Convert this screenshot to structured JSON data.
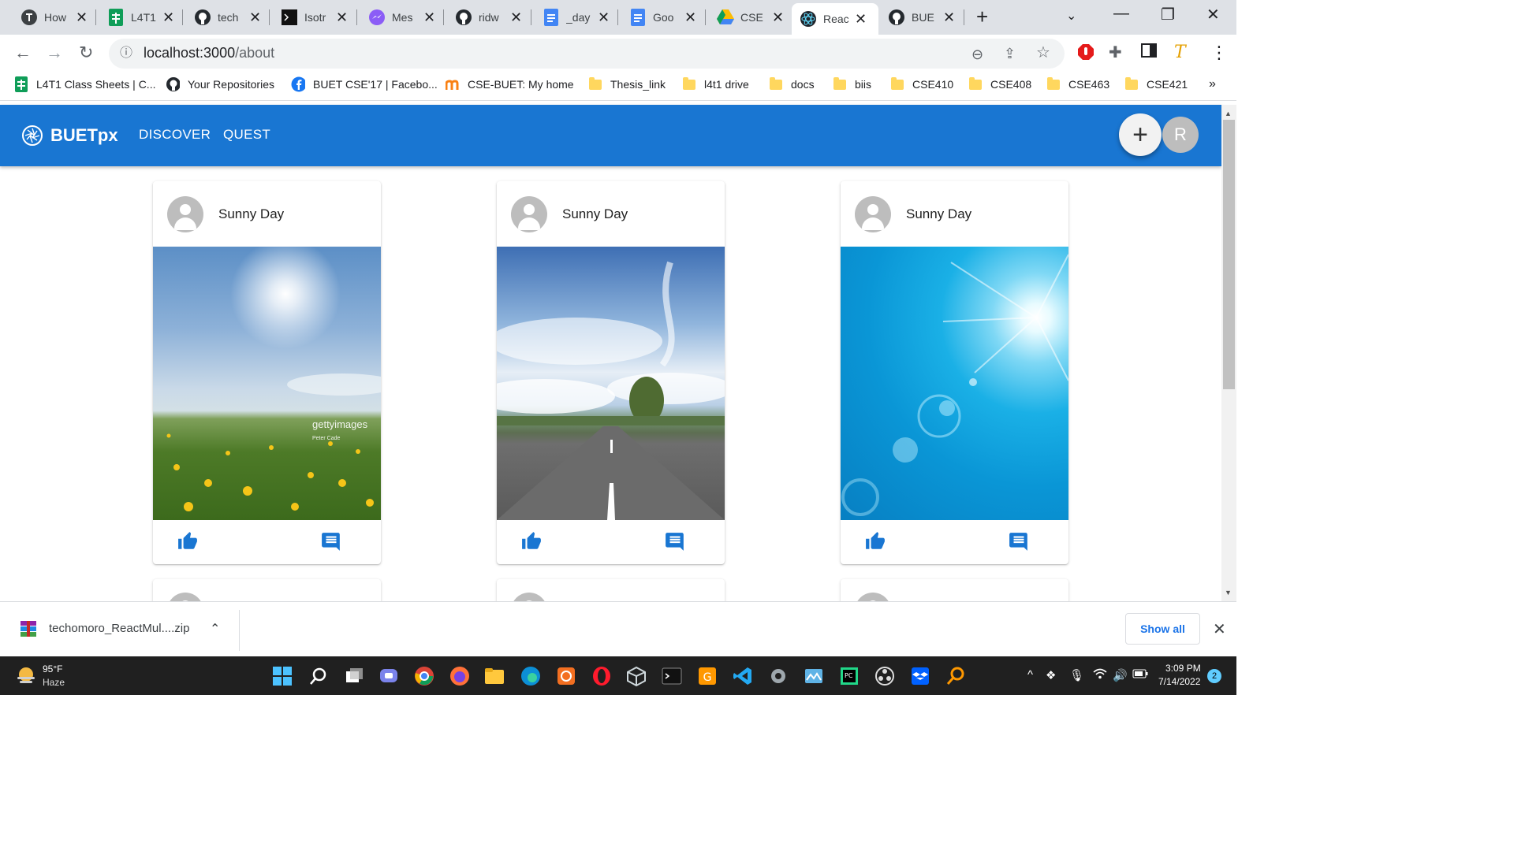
{
  "browser": {
    "tabs": [
      {
        "title": "How",
        "icon": "tor-icon",
        "color": "#3c4043"
      },
      {
        "title": "L4T1",
        "icon": "sheets-icon",
        "color": "#0f9d58"
      },
      {
        "title": "tech",
        "icon": "github-icon",
        "color": "#24292e"
      },
      {
        "title": "Isotr",
        "icon": "terminal-icon",
        "color": "#111111"
      },
      {
        "title": "Mes",
        "icon": "messenger-icon",
        "color": "#8b5cf6"
      },
      {
        "title": "ridw",
        "icon": "github-icon",
        "color": "#24292e"
      },
      {
        "title": "_day",
        "icon": "docs-icon",
        "color": "#4285f4"
      },
      {
        "title": "Goo",
        "icon": "docs-icon",
        "color": "#4285f4"
      },
      {
        "title": "CSE",
        "icon": "drive-icon",
        "color": "#fbbc04"
      },
      {
        "title": "Reac",
        "icon": "react-icon",
        "color": "#087ea4",
        "active": true
      },
      {
        "title": "BUE",
        "icon": "github-icon",
        "color": "#24292e"
      }
    ],
    "address": {
      "host": "localhost:3000",
      "path": "/about"
    },
    "bookmarks": [
      {
        "label": "L4T1 Class Sheets | C...",
        "icon": "sheets-icon"
      },
      {
        "label": "Your Repositories",
        "icon": "github-icon"
      },
      {
        "label": "BUET CSE'17 | Facebo...",
        "icon": "facebook-icon"
      },
      {
        "label": "CSE-BUET: My home",
        "icon": "moodle-icon"
      },
      {
        "label": "Thesis_link",
        "icon": "folder-icon"
      },
      {
        "label": "l4t1 drive",
        "icon": "folder-icon"
      },
      {
        "label": "docs",
        "icon": "folder-icon"
      },
      {
        "label": "biis",
        "icon": "folder-icon"
      },
      {
        "label": "CSE410",
        "icon": "folder-icon"
      },
      {
        "label": "CSE408",
        "icon": "folder-icon"
      },
      {
        "label": "CSE463",
        "icon": "folder-icon"
      },
      {
        "label": "CSE421",
        "icon": "folder-icon"
      }
    ],
    "more_bookmarks": "»"
  },
  "app": {
    "brand": "BUETpx",
    "nav": [
      "DISCOVER",
      "QUEST"
    ],
    "add_label": "+",
    "user_initial": "R",
    "accent": "#1976d2"
  },
  "cards": [
    {
      "title": "Sunny Day",
      "image": "field-sun-photo",
      "watermark": "gettyimages",
      "credit": "Peter Cade"
    },
    {
      "title": "Sunny Day",
      "image": "road-clouds-photo"
    },
    {
      "title": "Sunny Day",
      "image": "blue-sky-sun-photo"
    }
  ],
  "download": {
    "file": "techomoro_ReactMul....zip",
    "show_all": "Show all"
  },
  "taskbar": {
    "weather_temp": "95°F",
    "weather_cond": "Haze",
    "time": "3:09 PM",
    "date": "7/14/2022",
    "notifications": "2"
  }
}
